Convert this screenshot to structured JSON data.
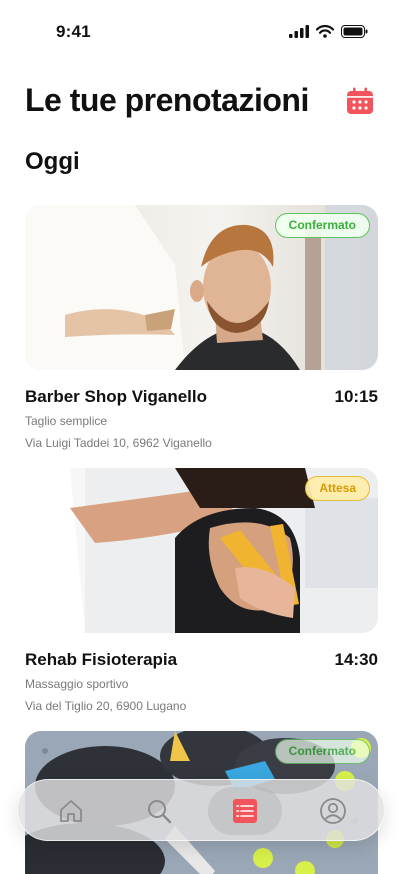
{
  "status_bar": {
    "time": "9:41"
  },
  "header": {
    "title": "Le tue prenotazioni",
    "calendar_icon": "calendar-icon",
    "accent": "#f2545b"
  },
  "section": {
    "title": "Oggi"
  },
  "bookings": [
    {
      "name": "Barber Shop Viganello",
      "time": "10:15",
      "service": "Taglio semplice",
      "address": "Via Luigi Taddei 10, 6962 Viganello",
      "status": "Confermato",
      "status_color": "#3cae3c"
    },
    {
      "name": "Rehab Fisioterapia",
      "time": "14:30",
      "service": "Massaggio sportivo",
      "address": "Via del Tiglio 20, 6900 Lugano",
      "status": "Attesa",
      "status_color": "#d99a00"
    },
    {
      "status": "Confermato",
      "status_color": "#3cae3c"
    }
  ],
  "tab_bar": {
    "items": [
      {
        "icon": "home-icon"
      },
      {
        "icon": "search-icon"
      },
      {
        "icon": "list-icon",
        "active": true
      },
      {
        "icon": "profile-icon"
      }
    ]
  }
}
